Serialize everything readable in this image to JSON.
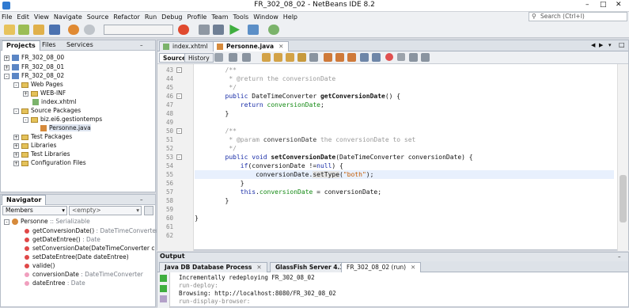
{
  "window": {
    "title": "FR_302_08_02 - NetBeans IDE 8.2"
  },
  "menu": [
    "File",
    "Edit",
    "View",
    "Navigate",
    "Source",
    "Refactor",
    "Run",
    "Debug",
    "Profile",
    "Team",
    "Tools",
    "Window",
    "Help"
  ],
  "search": {
    "placeholder": "Search (Ctrl+I)"
  },
  "projects": {
    "tabs": [
      "Projects",
      "Files",
      "Services"
    ],
    "tree": [
      {
        "label": "FR_302_08_00",
        "indent": 0
      },
      {
        "label": "FR_302_08_01",
        "indent": 0
      },
      {
        "label": "FR_302_08_02",
        "indent": 0
      },
      {
        "label": "Web Pages",
        "indent": 1
      },
      {
        "label": "WEB-INF",
        "indent": 2
      },
      {
        "label": "index.xhtml",
        "indent": 2
      },
      {
        "label": "Source Packages",
        "indent": 1
      },
      {
        "label": "biz.ei6.gestiontemps",
        "indent": 2
      },
      {
        "label": "Personne.java",
        "indent": 3
      },
      {
        "label": "Test Packages",
        "indent": 1
      },
      {
        "label": "Libraries",
        "indent": 1
      },
      {
        "label": "Test Libraries",
        "indent": 1
      },
      {
        "label": "Configuration Files",
        "indent": 1
      }
    ]
  },
  "navigator": {
    "title": "Navigator",
    "filter_left": "Members",
    "filter_right": "<empty>",
    "root": {
      "name": "Personne",
      "type": " :: Serializable"
    },
    "members": [
      {
        "name": "getConversionDate()",
        "type": " : DateTimeConverter"
      },
      {
        "name": "getDateEntree()",
        "type": " : Date"
      },
      {
        "name": "setConversionDate(",
        "type": "DateTimeConverter conversionD"
      },
      {
        "name": "setDateEntree(",
        "type": "Date dateEntree)"
      },
      {
        "name": "valide()",
        "type": ""
      },
      {
        "name": "conversionDate",
        "type": " : DateTimeConverter"
      },
      {
        "name": "dateEntree",
        "type": " : Date"
      }
    ]
  },
  "editor": {
    "tabs": [
      "index.xhtml",
      "Personne.java"
    ],
    "source_label": "Source",
    "history_label": "History",
    "line_numbers": [
      "43",
      "44",
      "45",
      "46",
      "47",
      "48",
      "49",
      "50",
      "51",
      "52",
      "53",
      "54",
      "55",
      "56",
      "57",
      "58",
      "59",
      "60",
      "61",
      "62"
    ],
    "code": {
      "l43": "/**",
      "l44": " * @return the conversionDate",
      "l45": " */",
      "l46a": "public ",
      "l46b": "DateTimeConverter ",
      "l46c": "getConversionDate",
      "l46d": "() {",
      "l47a": "return ",
      "l47b": "conversionDate",
      "l47c": ";",
      "l48": "}",
      "l50": "/**",
      "l51a": " * @param ",
      "l51b": "conversionDate",
      "l51c": " the conversionDate to set",
      "l52": " */",
      "l53a": "public void ",
      "l53b": "setConversionDate",
      "l53c": "(DateTimeConverter conversionDate) {",
      "l54a": "if",
      "l54b": "(conversionDate !=",
      "l54c": "null",
      "l54d": ") {",
      "l55a": "conversionDate.",
      "l55b": "setType",
      "l55c": "(",
      "l55d": "\"both\"",
      "l55e": ");",
      "l56": "}",
      "l57a": "this",
      "l57b": ".",
      "l57c": "conversionDate",
      "l57d": " = conversionDate;",
      "l58": "}",
      "l60": "}"
    }
  },
  "output": {
    "title": "Output",
    "tabs": [
      "Java DB Database Process",
      "GlassFish Server 4.1",
      "FR_302_08_02 (run)"
    ],
    "lines": [
      "Incrementally redeploying FR_302_08_02",
      "run-deploy:",
      "Browsing: http://localhost:8080/FR_302_08_02",
      "run-display-browser:"
    ]
  },
  "colors": {
    "keyword": "#1a2ea8",
    "field": "#148a14",
    "string": "#c45a00",
    "comment": "#9a9a9a"
  }
}
